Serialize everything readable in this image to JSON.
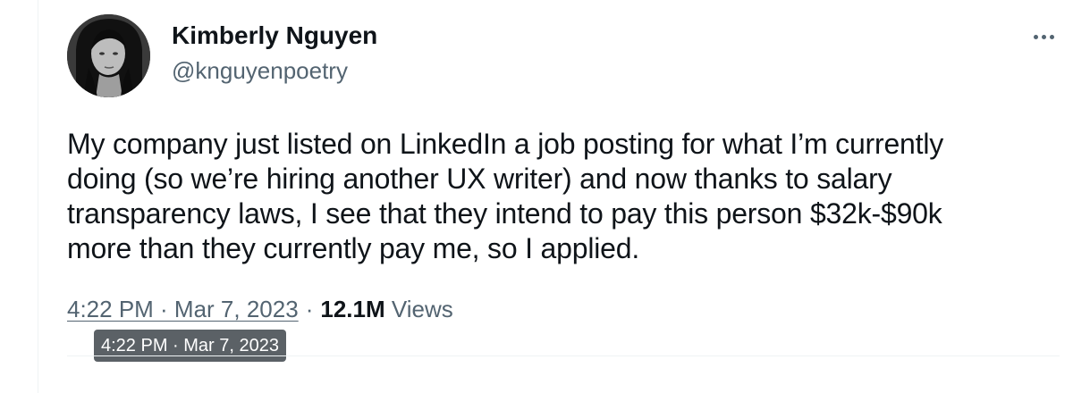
{
  "author": {
    "display_name": "Kimberly Nguyen",
    "handle": "@knguyenpoetry",
    "avatar_icon": "profile-photo"
  },
  "more_icon": "more-horizontal-icon",
  "tweet": {
    "lines": [
      "My company just listed on LinkedIn a job posting for what I’m currently",
      "doing (so we’re hiring another UX writer) and now thanks to salary",
      "transparency laws, I see that they intend to pay this person $32k-$90k",
      "more than they currently pay me, so I applied."
    ]
  },
  "meta": {
    "timestamp": "4:22 PM · Mar 7, 2023",
    "separator": "·",
    "views_count": "12.1M",
    "views_label": "Views"
  },
  "tooltip": {
    "text": "4:22 PM · Mar 7, 2023"
  },
  "colors": {
    "text": "#0f1419",
    "secondary": "#536471",
    "tooltip_bg": "#5b6166",
    "divider": "#eff3f4"
  }
}
